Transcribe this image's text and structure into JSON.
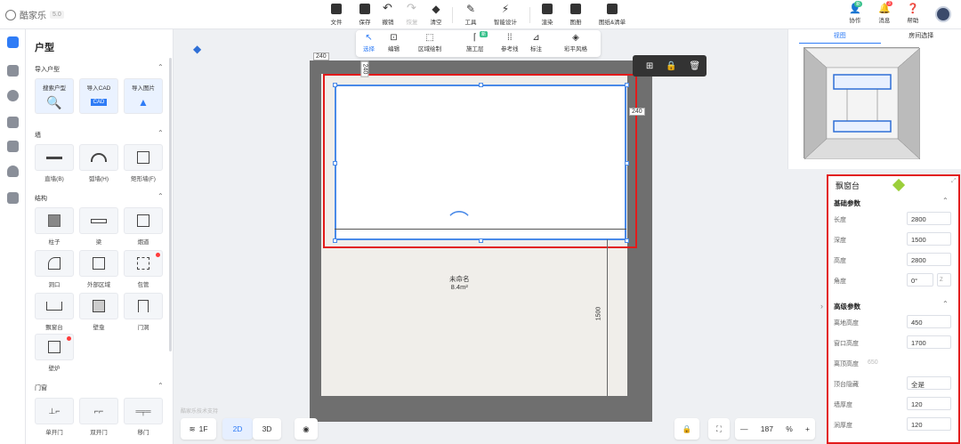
{
  "app": {
    "name": "酷家乐",
    "version": "5.0"
  },
  "toolbar": {
    "file": "文件",
    "save": "保存",
    "undo": "撤销",
    "redo": "恢复",
    "clear": "清空",
    "tools": "工具",
    "smart_design": "智能设计",
    "render": "渲染",
    "gallery": "图册",
    "drawings": "图纸&清单"
  },
  "topright": {
    "collab": "协作",
    "collab_badge": "新",
    "messages": "消息",
    "messages_badge": "3",
    "help": "帮助"
  },
  "left_panel": {
    "title": "户型",
    "import_section": "导入户型",
    "import_items": [
      {
        "label": "搜索户型"
      },
      {
        "label": "导入CAD"
      },
      {
        "label": "导入图片"
      }
    ],
    "wall_section": "墙",
    "wall_items": [
      {
        "label": "直墙(B)"
      },
      {
        "label": "弧墙(H)"
      },
      {
        "label": "矩形墙(F)"
      }
    ],
    "structure_section": "结构",
    "structure_items": [
      {
        "label": "柱子"
      },
      {
        "label": "梁"
      },
      {
        "label": "烟道"
      },
      {
        "label": "洞口"
      },
      {
        "label": "外部区域"
      },
      {
        "label": "包管"
      },
      {
        "label": "飘窗台"
      },
      {
        "label": "壁龛"
      },
      {
        "label": "门洞"
      },
      {
        "label": "壁炉"
      }
    ],
    "door_section": "门窗",
    "door_items": [
      {
        "label": "单开门"
      },
      {
        "label": "双开门"
      },
      {
        "label": "移门"
      }
    ]
  },
  "draw_toolbar": {
    "select": "选择",
    "edit": "编辑",
    "region": "区域绘制",
    "construct": "施工层",
    "construct_badge": "新",
    "reference": "参考线",
    "annotate": "标注",
    "style": "彩平风格"
  },
  "canvas": {
    "dim_top": "240",
    "dim_vertical_small": "240",
    "dim_right": "240",
    "dim_side": "1500",
    "room_name": "未命名",
    "room_area": "8.4m²",
    "watermark": "酷家乐技术支持"
  },
  "bottom": {
    "floor": "1F",
    "view2d": "2D",
    "view3d": "3D",
    "zoom": "187",
    "zoom_unit": "%"
  },
  "preview": {
    "tab_view": "视图",
    "tab_room": "房间选择"
  },
  "properties": {
    "title": "飘窗台",
    "basic_section": "基础参数",
    "basic": [
      {
        "label": "长度",
        "value": "2800"
      },
      {
        "label": "深度",
        "value": "1500"
      },
      {
        "label": "高度",
        "value": "2800"
      },
      {
        "label": "角度",
        "value": "0°",
        "unit": "Z"
      }
    ],
    "adv_section": "高级参数",
    "advanced": [
      {
        "label": "离地高度",
        "value": "450"
      },
      {
        "label": "窗口高度",
        "value": "1700"
      },
      {
        "label": "离顶高度",
        "plain": "650"
      },
      {
        "label": "顶台隐藏",
        "value": "全是"
      },
      {
        "label": "墙厚度",
        "value": "120"
      },
      {
        "label": "涧厚度",
        "value": "120"
      }
    ]
  },
  "colors": {
    "accent": "#2f7cf6",
    "highlight": "#e21b1b",
    "selection": "#4a8ae8"
  }
}
